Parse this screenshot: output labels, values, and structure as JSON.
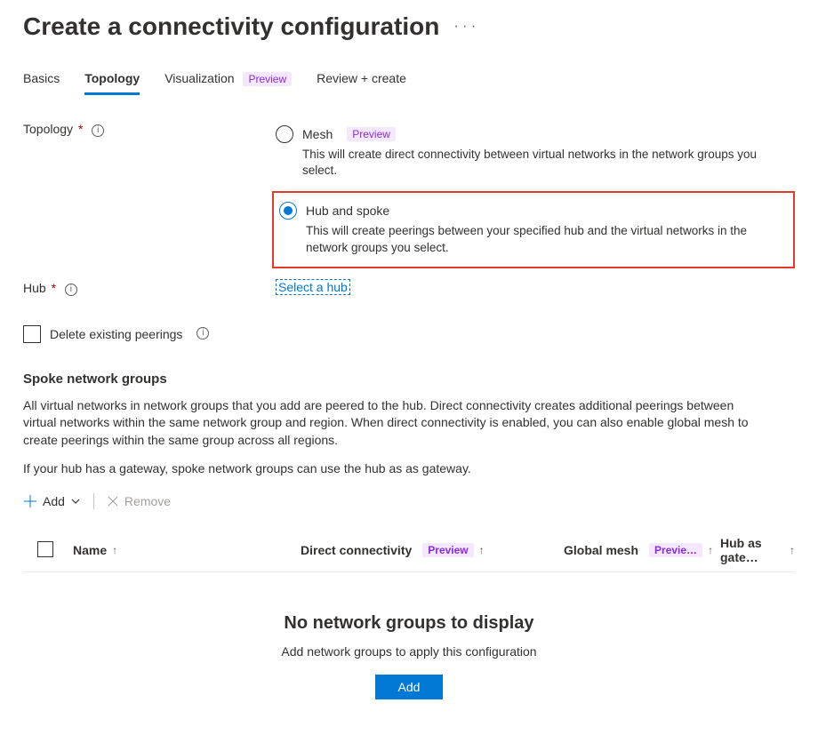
{
  "page": {
    "title": "Create a connectivity configuration"
  },
  "tabs": {
    "basics": "Basics",
    "topology": "Topology",
    "visualization": "Visualization",
    "viz_badge": "Preview",
    "review": "Review + create"
  },
  "fields": {
    "topology_label": "Topology",
    "hub_label": "Hub",
    "hub_link": "Select a hub",
    "delete_peerings": "Delete existing peerings"
  },
  "topology_options": {
    "mesh": {
      "title": "Mesh",
      "badge": "Preview",
      "desc": "This will create direct connectivity between virtual networks in the network groups you select."
    },
    "hubspoke": {
      "title": "Hub and spoke",
      "desc": "This will create peerings between your specified hub and the virtual networks in the network groups you select."
    }
  },
  "spoke": {
    "heading": "Spoke network groups",
    "desc1": "All virtual networks in network groups that you add are peered to the hub. Direct connectivity creates additional peerings between virtual networks within the same network group and region. When direct connectivity is enabled, you can also enable global mesh to create peerings within the same group across all regions.",
    "desc2": "If your hub has a gateway, spoke network groups can use the hub as as gateway."
  },
  "toolbar": {
    "add": "Add",
    "remove": "Remove"
  },
  "table": {
    "col_name": "Name",
    "col_direct": "Direct connectivity",
    "direct_badge": "Preview",
    "col_global": "Global mesh",
    "global_badge": "Previe…",
    "col_hubgw": "Hub as gate…"
  },
  "empty": {
    "title": "No network groups to display",
    "sub": "Add network groups to apply this configuration",
    "button": "Add"
  }
}
